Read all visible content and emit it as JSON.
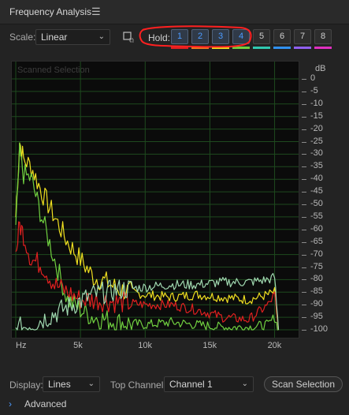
{
  "header": {
    "title": "Frequency Analysis",
    "menu_icon": "hamburger-icon"
  },
  "controls": {
    "scale_label": "Scale:",
    "scale_value": "Linear",
    "hold_label": "Hold:",
    "hold_buttons": [
      "1",
      "2",
      "3",
      "4",
      "5",
      "6",
      "7",
      "8"
    ],
    "hold_colors": [
      "#e02020",
      "#f07820",
      "#f0e020",
      "#70d040",
      "#30c8b0",
      "#3090f0",
      "#9060f0",
      "#e030c0"
    ],
    "active_holds": [
      1,
      2,
      3,
      4
    ],
    "annotation_color": "#ff2020"
  },
  "plot": {
    "scanned_label": "Scanned Selection",
    "x_ticks": [
      "Hz",
      "5k",
      "10k",
      "15k",
      "20k"
    ],
    "y_unit": "dB",
    "y_ticks": [
      "0",
      "-5",
      "-10",
      "-15",
      "-20",
      "-25",
      "-30",
      "-35",
      "-40",
      "-45",
      "-50",
      "-55",
      "-60",
      "-65",
      "-70",
      "-75",
      "-80",
      "-85",
      "-90",
      "-95",
      "-100"
    ],
    "grid_color": "#1e4a1e"
  },
  "chart_data": {
    "type": "line",
    "xlabel": "",
    "ylabel": "dB",
    "xlim": [
      0,
      21000
    ],
    "ylim": [
      -100,
      0
    ],
    "grid": true,
    "series": [
      {
        "color": "#f0e020",
        "x": [
          0,
          300,
          600,
          1200,
          2000,
          3000,
          4000,
          5000,
          6000,
          7000,
          8000,
          9000,
          10000,
          12000,
          14000,
          16000,
          18000,
          19500,
          20000,
          20300
        ],
        "y": [
          -55,
          -25,
          -32,
          -35,
          -45,
          -55,
          -65,
          -72,
          -79,
          -81,
          -84,
          -85,
          -86,
          -87,
          -86,
          -87,
          -88,
          -86,
          -85,
          -100
        ]
      },
      {
        "color": "#70d040",
        "x": [
          0,
          300,
          600,
          1200,
          2000,
          3000,
          4000,
          5000,
          6000,
          8000,
          10000,
          12000,
          14000,
          16000,
          18000,
          19500,
          20000,
          20300
        ],
        "y": [
          -60,
          -30,
          -38,
          -40,
          -55,
          -72,
          -88,
          -92,
          -95,
          -97,
          -98,
          -97,
          -98,
          -99,
          -99,
          -98,
          -95,
          -100
        ]
      },
      {
        "color": "#e02020",
        "x": [
          0,
          300,
          600,
          1200,
          2000,
          3000,
          4000,
          5000,
          6000,
          8000,
          10000,
          12000,
          14000,
          16000,
          18000,
          19500,
          20000,
          20300
        ],
        "y": [
          -70,
          -58,
          -62,
          -72,
          -74,
          -82,
          -85,
          -88,
          -88,
          -89,
          -90,
          -90,
          -92,
          -95,
          -96,
          -90,
          -86,
          -100
        ]
      },
      {
        "color": "#a0d8b0",
        "x": [
          0,
          2000,
          4000,
          6000,
          8000,
          10000,
          12000,
          14000,
          16000,
          18000,
          19500,
          20000,
          20300
        ],
        "y": [
          -100,
          -96,
          -91,
          -86,
          -84,
          -83,
          -82,
          -82,
          -81,
          -81,
          -80,
          -79,
          -100
        ]
      }
    ]
  },
  "footer": {
    "display_label": "Display:",
    "display_value": "Lines",
    "channel_label": "Top Channel:",
    "channel_value": "Channel 1",
    "scan_button": "Scan Selection",
    "advanced_label": "Advanced"
  }
}
